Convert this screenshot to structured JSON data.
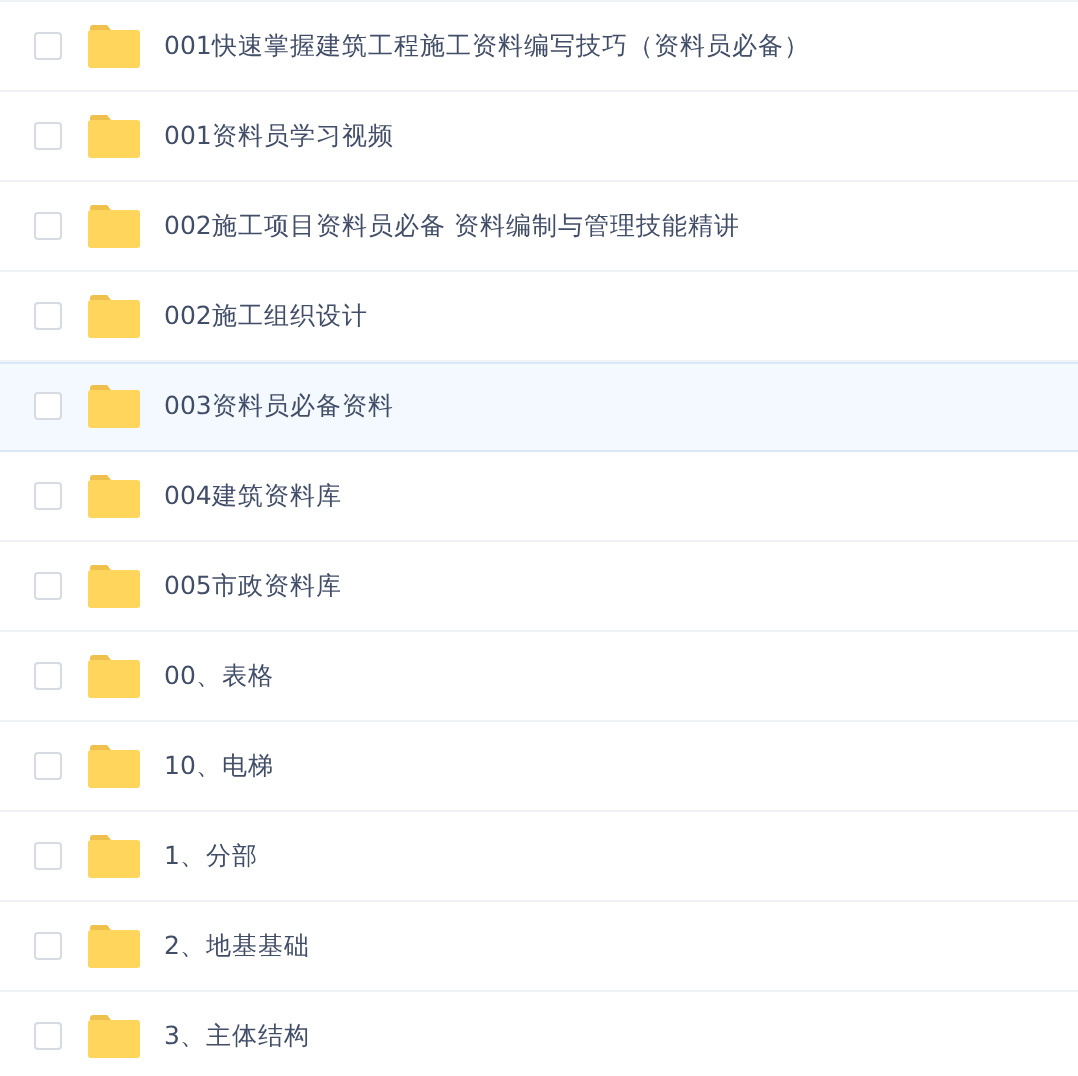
{
  "files": [
    {
      "name": "001快速掌握建筑工程施工资料编写技巧（资料员必备）",
      "checked": false,
      "selected": false
    },
    {
      "name": "001资料员学习视频",
      "checked": false,
      "selected": false
    },
    {
      "name": "002施工项目资料员必备 资料编制与管理技能精讲",
      "checked": false,
      "selected": false
    },
    {
      "name": "002施工组织设计",
      "checked": false,
      "selected": false
    },
    {
      "name": "003资料员必备资料",
      "checked": false,
      "selected": true
    },
    {
      "name": "004建筑资料库",
      "checked": false,
      "selected": false
    },
    {
      "name": "005市政资料库",
      "checked": false,
      "selected": false
    },
    {
      "name": "00、表格",
      "checked": false,
      "selected": false
    },
    {
      "name": "10、电梯",
      "checked": false,
      "selected": false
    },
    {
      "name": "1、分部",
      "checked": false,
      "selected": false
    },
    {
      "name": "2、地基基础",
      "checked": false,
      "selected": false
    },
    {
      "name": "3、主体结构",
      "checked": false,
      "selected": false
    }
  ]
}
